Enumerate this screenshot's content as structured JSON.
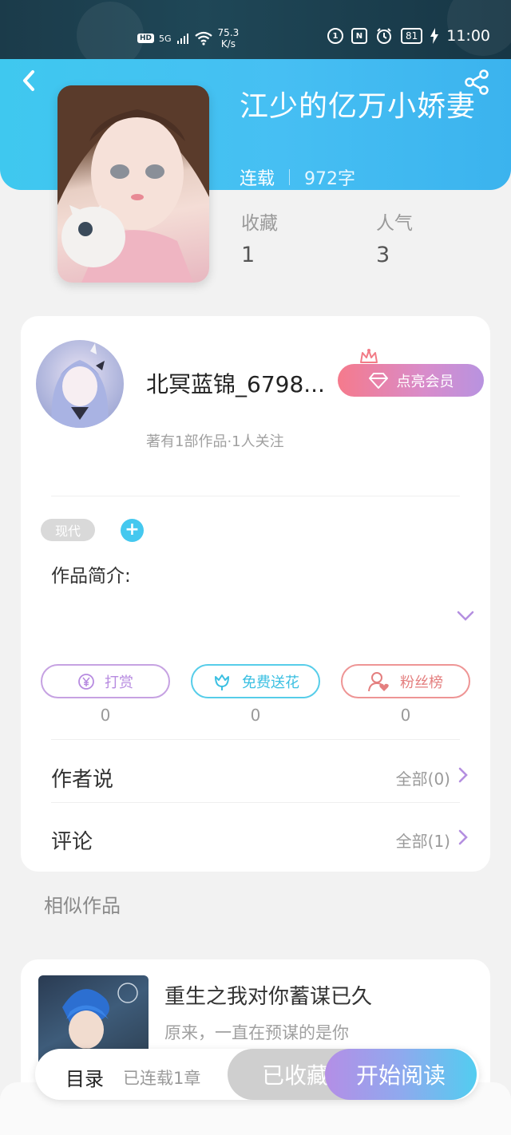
{
  "status_bar": {
    "hd": "HD",
    "network": "5G",
    "speed_value": "75.3",
    "speed_unit": "K/s",
    "battery": "81",
    "time": "11:00"
  },
  "book": {
    "title": "江少的亿万小娇妻",
    "status": "连载",
    "word_count": "972字",
    "stats": [
      {
        "label": "收藏",
        "value": "1"
      },
      {
        "label": "人气",
        "value": "3"
      }
    ]
  },
  "author": {
    "name": "北冥蓝锦_6798...",
    "meta": "著有1部作品·1人关注",
    "vip_button": "点亮会员"
  },
  "tags": [
    "现代"
  ],
  "tag_add": "+",
  "intro_label": "作品简介:",
  "actions": [
    {
      "label": "打赏",
      "icon": "yen-coin-icon",
      "count": "0"
    },
    {
      "label": "免费送花",
      "icon": "flower-icon",
      "count": "0"
    },
    {
      "label": "粉丝榜",
      "icon": "fans-user-heart-icon",
      "count": "0"
    }
  ],
  "rows": [
    {
      "title": "作者说",
      "all": "全部(0)"
    },
    {
      "title": "评论",
      "all": "全部(1)"
    }
  ],
  "similar": {
    "label": "相似作品",
    "items": [
      {
        "title": "重生之我对你蓄谋已久",
        "subtitle": "原来，一直在预谋的是你"
      }
    ]
  },
  "bottom": {
    "toc": "目录",
    "toc_sub": "已连载1章",
    "collected": "已收藏",
    "read": "开始阅读"
  },
  "colors": {
    "header_blue": "#42c3f1",
    "vip_gradient_start": "#f57a8c",
    "vip_gradient_end": "#b893e0",
    "accent_purple": "#b78be0",
    "accent_cyan": "#3cc0e2",
    "accent_red": "#e47f7f"
  }
}
